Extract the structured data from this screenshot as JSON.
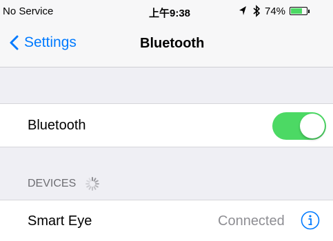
{
  "status_bar": {
    "carrier": "No Service",
    "time": "上午9:38",
    "battery_percent": "74%",
    "battery_level": 0.74
  },
  "nav": {
    "back_label": "Settings",
    "title": "Bluetooth"
  },
  "bluetooth": {
    "label": "Bluetooth",
    "enabled": true
  },
  "devices": {
    "header": "DEVICES",
    "items": [
      {
        "name": "Smart Eye",
        "status": "Connected"
      }
    ]
  },
  "colors": {
    "accent": "#007aff",
    "toggle_on": "#4cd964",
    "background": "#efeff4",
    "secondary_text": "#8e8e93"
  },
  "icons": {
    "back": "chevron-left-icon",
    "location": "location-arrow-icon",
    "bluetooth": "bluetooth-icon",
    "battery": "battery-icon",
    "spinner": "spinner-icon",
    "info": "info-icon"
  }
}
